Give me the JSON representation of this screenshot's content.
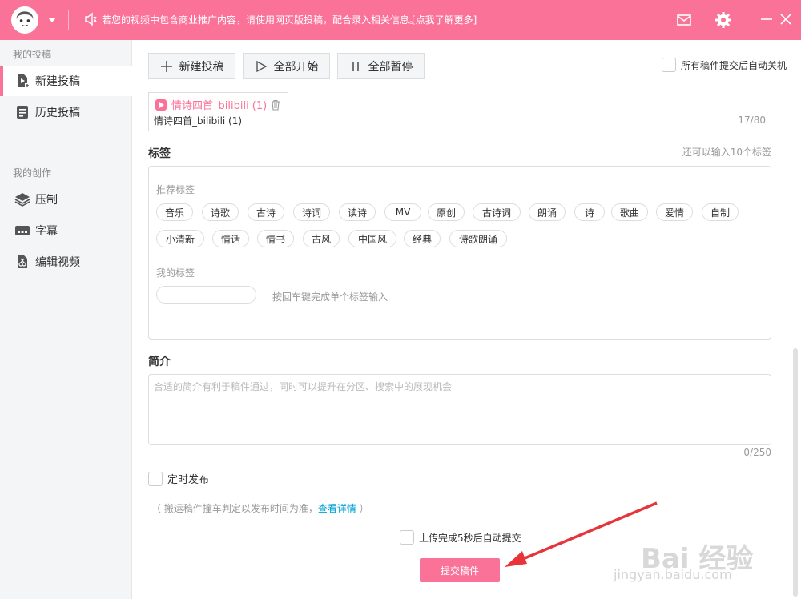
{
  "topbar": {
    "notice": "若您的视频中包含商业推广内容，请使用网页版投稿，配合录入相关信息。",
    "notice_link": "[点我了解更多]"
  },
  "sidebar": {
    "section1": "我的投稿",
    "items1": [
      {
        "label": "新建投稿",
        "icon": "upload-icon"
      },
      {
        "label": "历史投稿",
        "icon": "history-icon"
      }
    ],
    "section2": "我的创作",
    "items2": [
      {
        "label": "压制",
        "icon": "layers-icon"
      },
      {
        "label": "字幕",
        "icon": "subtitle-icon"
      },
      {
        "label": "编辑视频",
        "icon": "scissors-icon"
      }
    ]
  },
  "toolbar": {
    "new_label": "新建投稿",
    "start_label": "全部开始",
    "pause_label": "全部暂停",
    "auto_shutdown": "所有稿件提交后自动关机"
  },
  "file_tab": {
    "name": "情诗四首_bilibili (1)"
  },
  "title_field": {
    "value": "情诗四首_bilibili (1)",
    "count": "17/80"
  },
  "tags": {
    "label": "标签",
    "hint": "还可以输入10个标签",
    "recommended_label": "推荐标签",
    "recommended": [
      "音乐",
      "诗歌",
      "古诗",
      "诗词",
      "读诗",
      "MV",
      "原创",
      "古诗词",
      "朗诵",
      "诗",
      "歌曲",
      "爱情",
      "自制",
      "小清新",
      "情话",
      "情书",
      "古风",
      "中国风",
      "经典",
      "诗歌朗诵"
    ],
    "mine_label": "我的标签",
    "mine_hint": "按回车键完成单个标签输入"
  },
  "description": {
    "label": "简介",
    "placeholder": "合适的简介有利于稿件通过，同时可以提升在分区、搜索中的展现机会",
    "count": "0/250"
  },
  "schedule": {
    "label": "定时发布",
    "note_prefix": "（ 搬运稿件撞车判定以发布时间为准，",
    "note_link": "查看详情",
    "note_suffix": " ）"
  },
  "submit": {
    "auto_submit": "上传完成5秒后自动提交",
    "button": "提交稿件"
  },
  "watermark": {
    "text": "Bai 经验",
    "url": "jingyan.baidu.com"
  },
  "colors": {
    "accent": "#fb7299",
    "link": "#00a1d6"
  }
}
